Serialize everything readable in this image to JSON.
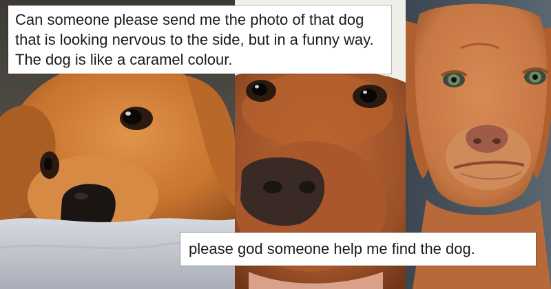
{
  "captions": {
    "top": "Can someone please send me the photo of that dog that is looking nervous to the side, but in a funny way. The dog is like a caramel colour.",
    "bottom": "please god someone help me find the dog."
  },
  "photos": [
    {
      "subject": "golden-retriever-side-eye",
      "colors": {
        "fur": "#c8742e",
        "blanket": "#c9cdd6"
      }
    },
    {
      "subject": "brown-dog-closeup",
      "colors": {
        "fur": "#a4582c",
        "background": "#f0eee8"
      }
    },
    {
      "subject": "vizsla-puppy-smirk",
      "colors": {
        "fur": "#c67743",
        "background": "#4a5660"
      }
    }
  ]
}
